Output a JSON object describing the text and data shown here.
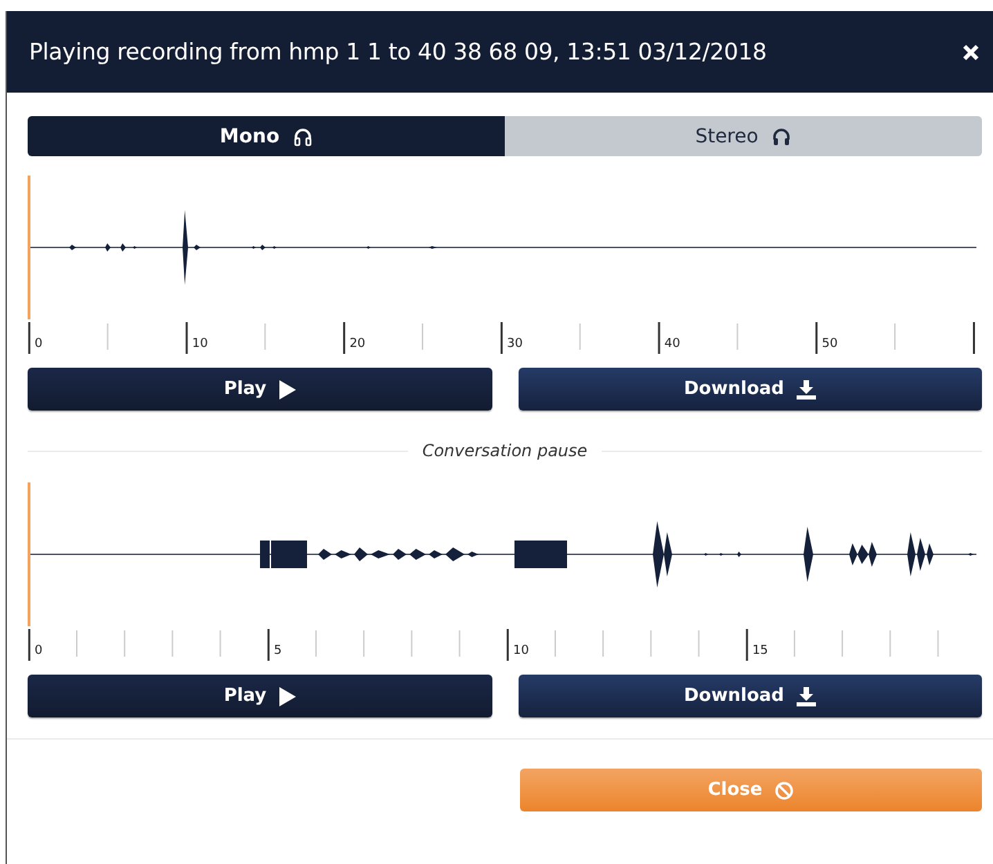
{
  "dialog": {
    "title": "Playing recording from hmp 1 1 to 40 38 68 09, 13:51 03/12/2018"
  },
  "tabs": [
    {
      "label": "Mono",
      "selected": true
    },
    {
      "label": "Stereo",
      "selected": false
    }
  ],
  "tracks": [
    {
      "ticks": [
        "0",
        "10",
        "20",
        "30",
        "40",
        "50"
      ],
      "play_button": "Play",
      "download_button": "Download"
    },
    {
      "pause_label": "Conversation pause",
      "ticks": [
        "0",
        "5",
        "10",
        "15"
      ],
      "play_button": "Play",
      "download_button": "Download"
    }
  ],
  "footer": {
    "close_button": "Close"
  }
}
